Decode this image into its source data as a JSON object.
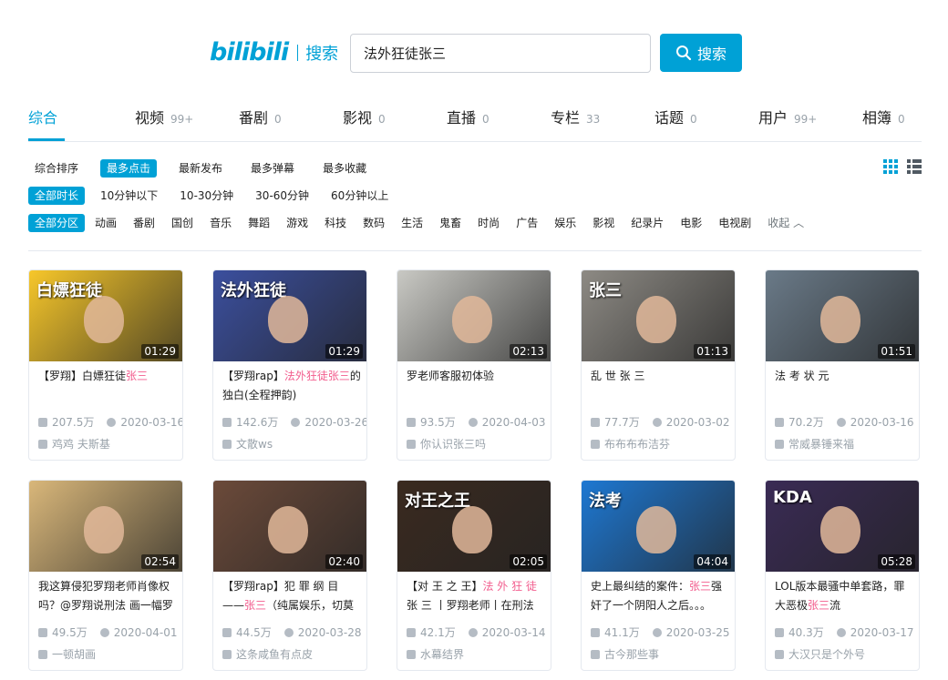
{
  "header": {
    "logo": "bilibili",
    "logo_suffix": "搜索",
    "search_value": "法外狂徒张三",
    "search_button": "搜索"
  },
  "tabs": [
    {
      "label": "综合",
      "count": ""
    },
    {
      "label": "视频",
      "count": "99+"
    },
    {
      "label": "番剧",
      "count": "0"
    },
    {
      "label": "影视",
      "count": "0"
    },
    {
      "label": "直播",
      "count": "0"
    },
    {
      "label": "专栏",
      "count": "33"
    },
    {
      "label": "话题",
      "count": "0"
    },
    {
      "label": "用户",
      "count": "99+"
    },
    {
      "label": "相簿",
      "count": "0"
    }
  ],
  "filters": {
    "order": [
      "综合排序",
      "最多点击",
      "最新发布",
      "最多弹幕",
      "最多收藏"
    ],
    "duration": [
      "全部时长",
      "10分钟以下",
      "10-30分钟",
      "30-60分钟",
      "60分钟以上"
    ],
    "zone": [
      "全部分区",
      "动画",
      "番剧",
      "国创",
      "音乐",
      "舞蹈",
      "游戏",
      "科技",
      "数码",
      "生活",
      "鬼畜",
      "时尚",
      "广告",
      "娱乐",
      "影视",
      "纪录片",
      "电影",
      "电视剧",
      "收起"
    ]
  },
  "videos": [
    {
      "t1": "【罗翔】白嫖狂徒",
      "t2": "张三",
      "t3": "",
      "dur": "01:29",
      "plays": "207.5万",
      "date": "2020-03-16",
      "up": "鸡鸡 夫斯基",
      "thumb": "#f7c72a",
      "thumb_text": "白嫖狂徒"
    },
    {
      "t1": "【罗翔rap】",
      "t2": "法外狂徒张三",
      "t3": "的独白(全程押韵)",
      "dur": "01:29",
      "plays": "142.6万",
      "date": "2020-03-26",
      "up": "文散ws",
      "thumb": "#3b4f9e",
      "thumb_text": "法外狂徒"
    },
    {
      "t1": "罗老师客服初体验",
      "t2": "",
      "t3": "",
      "dur": "02:13",
      "plays": "93.5万",
      "date": "2020-04-03",
      "up": "你认识张三吗",
      "thumb": "#c9c9c4",
      "thumb_text": ""
    },
    {
      "t1": "乱 世 张 三",
      "t2": "",
      "t3": "",
      "dur": "01:13",
      "plays": "77.7万",
      "date": "2020-03-02",
      "up": "布布布布洁芬",
      "thumb": "#8d8a84",
      "thumb_text": "张三"
    },
    {
      "t1": "法 考 状 元",
      "t2": "",
      "t3": "",
      "dur": "01:51",
      "plays": "70.2万",
      "date": "2020-03-16",
      "up": "常威暴锤来福",
      "thumb": "#6a7a88",
      "thumb_text": ""
    },
    {
      "t1": "我这算侵犯罗翔老师肖像权吗？@罗翔说刑法 画一幅罗",
      "t2": "",
      "t3": "",
      "dur": "02:54",
      "plays": "49.5万",
      "date": "2020-04-01",
      "up": "一顿胡画",
      "thumb": "#d9b77a",
      "thumb_text": ""
    },
    {
      "t1": "【罗翔rap】犯 罪 纲 目 ——",
      "t2": "张三",
      "t3": "（纯属娱乐，切莫",
      "dur": "02:40",
      "plays": "44.5万",
      "date": "2020-03-28",
      "up": "这条咸鱼有点皮",
      "thumb": "#6b4a3a",
      "thumb_text": ""
    },
    {
      "t1": "【对 王 之 王】",
      "t2": "法 外 狂 徒",
      "t3": " 张 三 丨罗翔老师丨在刑法",
      "dur": "02:05",
      "plays": "42.1万",
      "date": "2020-03-14",
      "up": "水幕结界",
      "thumb": "#3a2a20",
      "thumb_text": "对王之王"
    },
    {
      "t1": "史上最纠结的案件：",
      "t2": "张三",
      "t3": "强奸了一个阴阳人之后。。。",
      "dur": "04:04",
      "plays": "41.1万",
      "date": "2020-03-25",
      "up": "古今那些事",
      "thumb": "#1e78d2",
      "thumb_text": "法考"
    },
    {
      "t1": "LOL版本最骚中单套路，罪大恶极",
      "t2": "张三",
      "t3": "流",
      "dur": "05:28",
      "plays": "40.3万",
      "date": "2020-03-17",
      "up": "大汉只是个外号",
      "thumb": "#3a2b55",
      "thumb_text": "KDA"
    }
  ]
}
